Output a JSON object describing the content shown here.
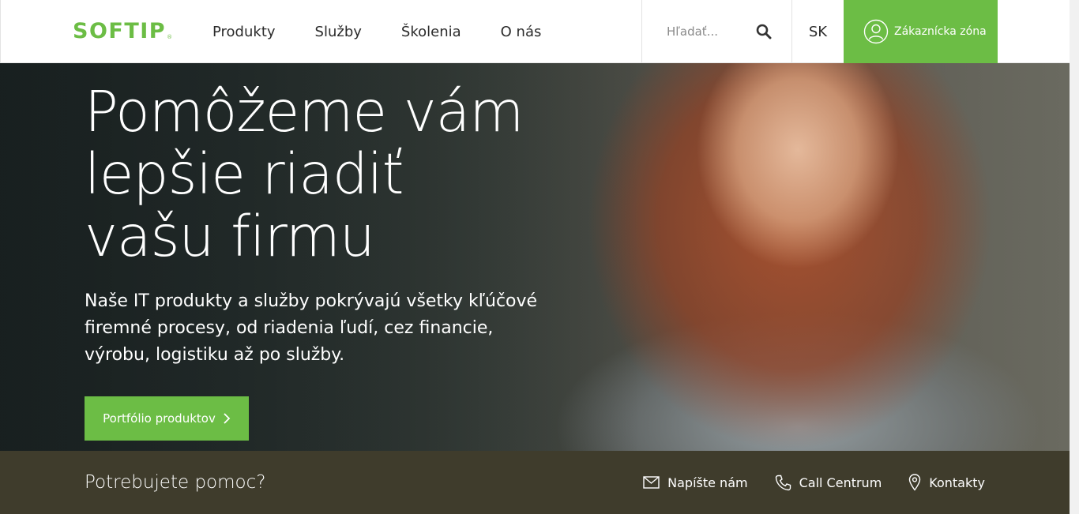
{
  "brand": {
    "logo_text": "SOFTIP",
    "logo_mark": "®",
    "accent": "#6cbd45",
    "dark": "#3f3c2c"
  },
  "nav": {
    "items": [
      {
        "label": "Produkty"
      },
      {
        "label": "Služby"
      },
      {
        "label": "Školenia"
      },
      {
        "label": "O nás"
      }
    ]
  },
  "search": {
    "placeholder": "Hľadať...",
    "icon": "search-icon"
  },
  "language": {
    "current": "SK"
  },
  "customer_zone": {
    "label": "Zákaznícka zóna",
    "icon": "user-icon"
  },
  "hero": {
    "title_lines": [
      "Pomôžeme vám",
      "lepšie riadiť",
      "vašu firmu"
    ],
    "subtitle": "Naše IT produkty a služby pokrývajú všetky kľúčové firemné procesy, od riadenia ľudí, cez financie, výrobu, logistiku až po služby.",
    "cta_label": "Portfólio produktov",
    "cta_icon": "chevron-right-icon"
  },
  "help": {
    "title": "Potrebujete pomoc?",
    "links": [
      {
        "label": "Napíšte nám",
        "icon": "mail-icon"
      },
      {
        "label": "Call Centrum",
        "icon": "phone-icon"
      },
      {
        "label": "Kontakty",
        "icon": "map-pin-icon"
      }
    ]
  }
}
